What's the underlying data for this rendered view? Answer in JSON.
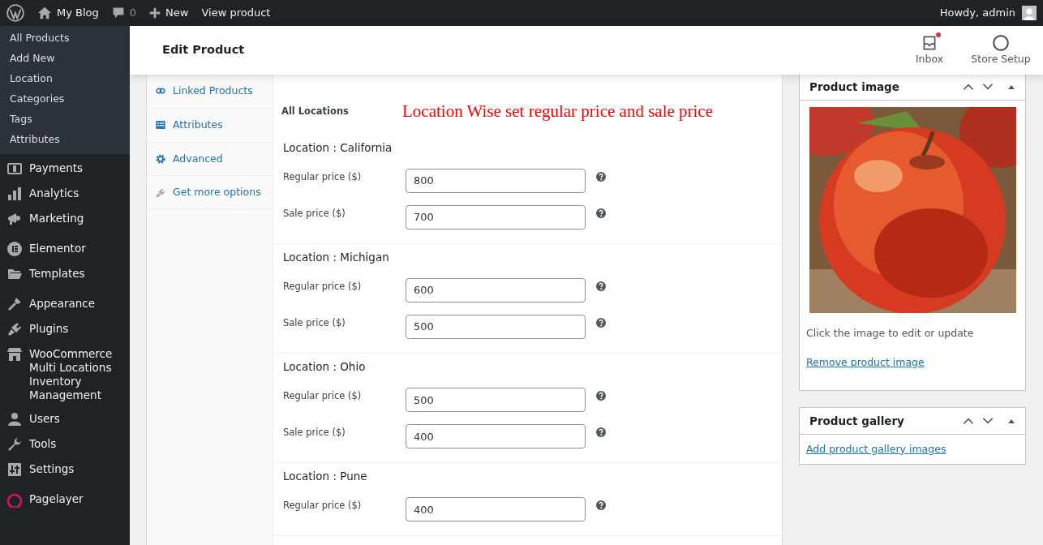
{
  "admin_bar": {
    "site": "My Blog",
    "comments": "0",
    "new": "New",
    "view": "View product",
    "greeting": "Howdy, admin"
  },
  "sidebar": {
    "sub_items": [
      {
        "label": "All Products"
      },
      {
        "label": "Add New"
      },
      {
        "label": "Location"
      },
      {
        "label": "Categories"
      },
      {
        "label": "Tags"
      },
      {
        "label": "Attributes"
      }
    ],
    "groups": [
      [
        {
          "label": "Payments"
        },
        {
          "label": "Analytics"
        },
        {
          "label": "Marketing"
        }
      ],
      [
        {
          "label": "Elementor"
        },
        {
          "label": "Templates"
        }
      ],
      [
        {
          "label": "Appearance"
        },
        {
          "label": "Plugins"
        },
        {
          "label": "WooCommerce Multi Locations Inventory Management"
        },
        {
          "label": "Users"
        },
        {
          "label": "Tools"
        },
        {
          "label": "Settings"
        }
      ],
      [
        {
          "label": "Pagelayer"
        }
      ]
    ]
  },
  "header": {
    "title": "Edit Product",
    "actions": [
      {
        "label": "Inbox",
        "notification": true
      },
      {
        "label": "Store Setup",
        "notification": false
      }
    ]
  },
  "product_tabs": [
    {
      "label": "Linked Products"
    },
    {
      "label": "Attributes"
    },
    {
      "label": "Advanced"
    },
    {
      "label": "Get more options"
    }
  ],
  "locations": {
    "heading": "All Locations",
    "annotation": "Location Wise set regular price and sale price",
    "groups": [
      {
        "title": "Location : California",
        "fields": [
          {
            "label": "Regular price ($)",
            "value": "800"
          },
          {
            "label": "Sale price ($)",
            "value": "700"
          }
        ]
      },
      {
        "title": "Location : Michigan",
        "fields": [
          {
            "label": "Regular price ($)",
            "value": "600"
          },
          {
            "label": "Sale price ($)",
            "value": "500"
          }
        ]
      },
      {
        "title": "Location : Ohio",
        "fields": [
          {
            "label": "Regular price ($)",
            "value": "500"
          },
          {
            "label": "Sale price ($)",
            "value": "400"
          }
        ]
      },
      {
        "title": "Location : Pune",
        "fields": [
          {
            "label": "Regular price ($)",
            "value": "400"
          }
        ]
      }
    ]
  },
  "product_image": {
    "title": "Product image",
    "hint": "Click the image to edit or update",
    "link": "Remove product image"
  },
  "product_gallery": {
    "title": "Product gallery",
    "link": "Add product gallery images"
  }
}
